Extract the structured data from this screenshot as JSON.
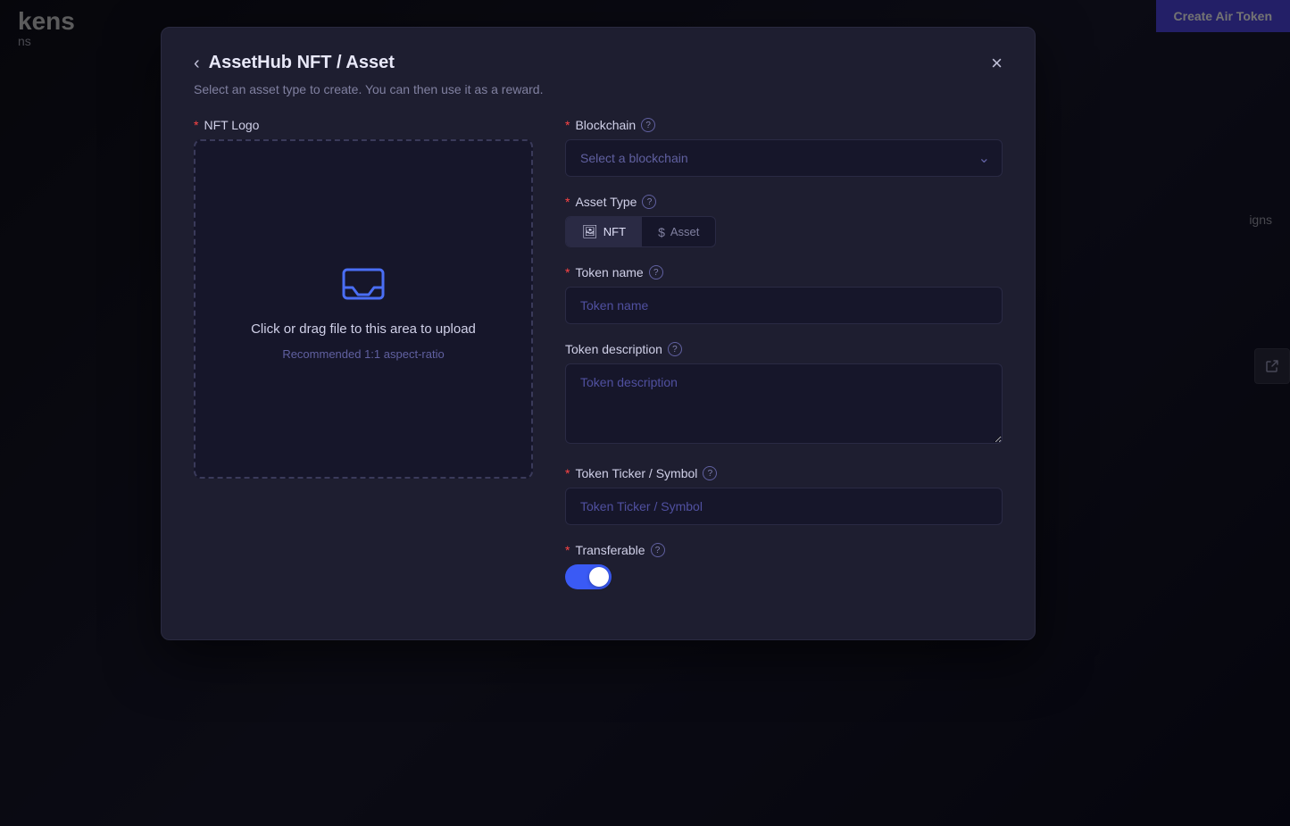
{
  "page": {
    "background_title": "kens",
    "background_subtitle": "ns",
    "background_designs": "igns"
  },
  "header": {
    "create_air_token_label": "Create Air Token"
  },
  "modal": {
    "back_label": "‹",
    "title": "AssetHub NFT / Asset",
    "close_label": "×",
    "subtitle": "Select an asset type to create. You can then use it as a reward.",
    "nft_logo_label": "NFT Logo",
    "upload_text": "Click or drag file to this area to upload",
    "upload_hint": "Recommended 1:1 aspect-ratio",
    "blockchain_label": "Blockchain",
    "blockchain_placeholder": "Select a blockchain",
    "asset_type_label": "Asset Type",
    "nft_btn_label": "NFT",
    "asset_btn_label": "Asset",
    "token_name_label": "Token name",
    "token_name_placeholder": "Token name",
    "token_desc_label": "Token description",
    "token_desc_placeholder": "Token description",
    "token_ticker_label": "Token Ticker / Symbol",
    "token_ticker_placeholder": "Token Ticker / Symbol",
    "transferable_label": "Transferable"
  }
}
